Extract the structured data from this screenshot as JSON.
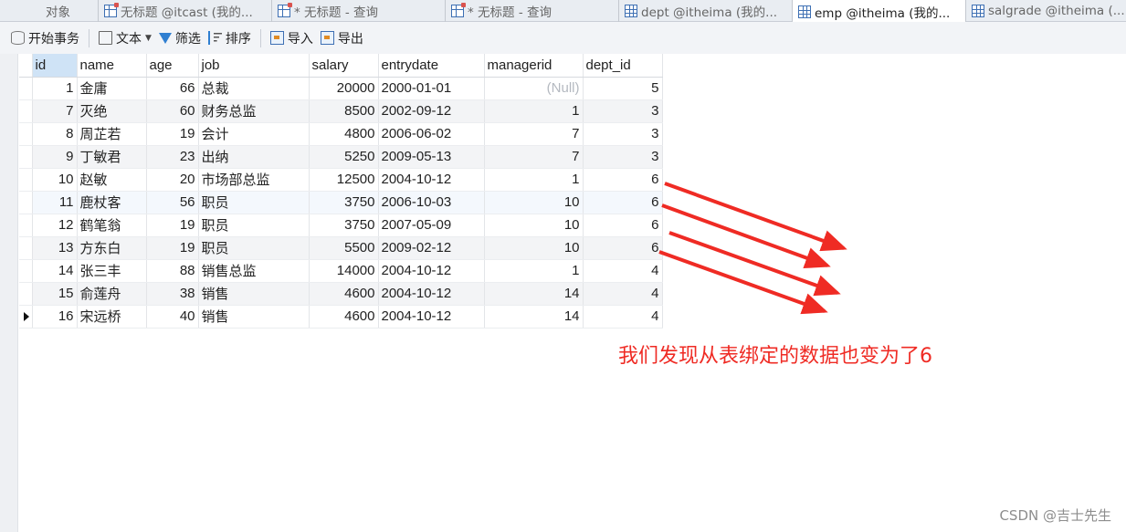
{
  "tabs": [
    {
      "label": "对象",
      "icon": "none",
      "active": false
    },
    {
      "label": "无标题 @itcast (我的...",
      "icon": "query-icon",
      "active": false
    },
    {
      "label": "* 无标题 - 查询",
      "icon": "query-icon",
      "active": false
    },
    {
      "label": "* 无标题 - 查询",
      "icon": "query-icon",
      "active": false
    },
    {
      "label": "dept @itheima (我的...",
      "icon": "table-icon",
      "active": false
    },
    {
      "label": "emp @itheima (我的...",
      "icon": "table-icon",
      "active": true
    },
    {
      "label": "salgrade @itheima (...",
      "icon": "table-icon",
      "active": false
    }
  ],
  "toolbar": {
    "begin_transaction": "开始事务",
    "text": "文本",
    "filter": "筛选",
    "sort": "排序",
    "import": "导入",
    "export": "导出"
  },
  "grid": {
    "columns": [
      "id",
      "name",
      "age",
      "job",
      "salary",
      "entrydate",
      "managerid",
      "dept_id"
    ],
    "selected_column": "id",
    "current_row": 10,
    "rows": [
      [
        "1",
        "金庸",
        "66",
        "总裁",
        "20000",
        "2000-01-01",
        "(Null)",
        "5"
      ],
      [
        "7",
        "灭绝",
        "60",
        "财务总监",
        "8500",
        "2002-09-12",
        "1",
        "3"
      ],
      [
        "8",
        "周芷若",
        "19",
        "会计",
        "4800",
        "2006-06-02",
        "7",
        "3"
      ],
      [
        "9",
        "丁敏君",
        "23",
        "出纳",
        "5250",
        "2009-05-13",
        "7",
        "3"
      ],
      [
        "10",
        "赵敏",
        "20",
        "市场部总监",
        "12500",
        "2004-10-12",
        "1",
        "6"
      ],
      [
        "11",
        "鹿杖客",
        "56",
        "职员",
        "3750",
        "2006-10-03",
        "10",
        "6"
      ],
      [
        "12",
        "鹤笔翁",
        "19",
        "职员",
        "3750",
        "2007-05-09",
        "10",
        "6"
      ],
      [
        "13",
        "方东白",
        "19",
        "职员",
        "5500",
        "2009-02-12",
        "10",
        "6"
      ],
      [
        "14",
        "张三丰",
        "88",
        "销售总监",
        "14000",
        "2004-10-12",
        "1",
        "4"
      ],
      [
        "15",
        "俞莲舟",
        "38",
        "销售",
        "4600",
        "2004-10-12",
        "14",
        "4"
      ],
      [
        "16",
        "宋远桥",
        "40",
        "销售",
        "4600",
        "2004-10-12",
        "14",
        "4"
      ]
    ]
  },
  "annotation": {
    "text": "我们发现从表绑定的数据也变为了6",
    "color": "#ef2b24"
  },
  "watermark": "CSDN @吉士先生",
  "colors": {
    "selected_header": "#cfe3f6",
    "null_text": "#b4b9c0",
    "tab_bar": "#e9edf2"
  }
}
